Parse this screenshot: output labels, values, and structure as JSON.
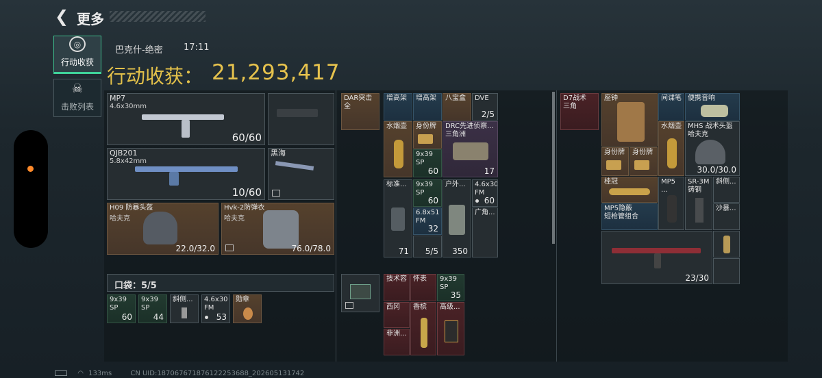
{
  "topbar": {
    "back_icon": "chevron-left-icon",
    "title": "更多"
  },
  "sidebar": {
    "tabs": [
      {
        "label": "行动收获",
        "icon": "loot-icon",
        "active": true
      },
      {
        "label": "击败列表",
        "icon": "skull-icon",
        "active": false
      }
    ]
  },
  "header": {
    "map": "巴克什-绝密",
    "time": "17:11",
    "loot_label": "行动收获：",
    "loot_value": "21,293,417"
  },
  "equipment": {
    "primary": {
      "name": "MP7",
      "caliber": "4.6x30mm",
      "ammo": "60/60"
    },
    "secondary": {
      "name": "QJB201",
      "caliber": "5.8x42mm",
      "ammo": "10/60"
    },
    "melee": {
      "name": "黑海"
    },
    "helmet": {
      "name": "H09 防暴头盔",
      "brand": "哈夫克",
      "durability": "22.0/32.0"
    },
    "armor": {
      "name": "Hvk-2防弹衣",
      "brand": "哈夫克",
      "durability": "76.0/78.0"
    }
  },
  "pocket": {
    "label": "口袋：",
    "count": "5/5",
    "items": [
      {
        "name": "9x39\nSP",
        "count": "60"
      },
      {
        "name": "9x39\nSP",
        "count": "44"
      },
      {
        "name": "斜侧..."
      },
      {
        "name": "4.6x30\nFM",
        "count": "53"
      },
      {
        "name": "勋章"
      }
    ]
  },
  "backpack": {
    "chest_rig": {
      "name": "DAR突击\n全"
    },
    "items": [
      {
        "name": "增高架"
      },
      {
        "name": "增高架"
      },
      {
        "name": "八宝盒"
      },
      {
        "name": "DVE",
        "count": "2/5"
      },
      {
        "name": "水烟壶"
      },
      {
        "name": "身份牌"
      },
      {
        "name": "DRC先进侦察...\n三角洲",
        "count": "17"
      },
      {
        "name": "9x39\nSP",
        "count": "60"
      },
      {
        "name": "标准..."
      },
      {
        "name": "9x39\nSP",
        "count": "60"
      },
      {
        "name": "户外..."
      },
      {
        "name": "4.6x30\nFM",
        "count": "60"
      },
      {
        "name": "6.8x51\nFM",
        "count": "32"
      },
      {
        "name": "广角..."
      },
      {
        "name": "",
        "count": "71"
      },
      {
        "name": "",
        "count": "5/5"
      },
      {
        "name": "",
        "count": "350"
      }
    ],
    "case_items": [
      {
        "name": "技术容"
      },
      {
        "name": "怀表"
      },
      {
        "name": "9x39\nSP",
        "count": "35"
      },
      {
        "name": "西冈"
      },
      {
        "name": "香槟"
      },
      {
        "name": "高级..."
      },
      {
        "name": "非洲..."
      }
    ]
  },
  "right": {
    "rig": {
      "name": "D7战术\n三角"
    },
    "items": [
      {
        "name": "座钟"
      },
      {
        "name": "间谍笔"
      },
      {
        "name": "便携音响"
      },
      {
        "name": "水烟壶"
      },
      {
        "name": "MHS 战术头盔\n哈夫克",
        "count": "30.0/30.0"
      },
      {
        "name": "身份牌"
      },
      {
        "name": "身份牌"
      },
      {
        "name": "桂冠"
      },
      {
        "name": "MP5 ..."
      },
      {
        "name": "SR-3M\n铸钢"
      },
      {
        "name": "斜侧..."
      },
      {
        "name": "沙暴..."
      },
      {
        "name": "MP5隐蔽\n短枪管组合"
      },
      {
        "name": "",
        "count": "23/30"
      }
    ]
  },
  "footer": {
    "ping": "133ms",
    "uid": "CN UID:18706767187612225368​8_202605131742"
  }
}
